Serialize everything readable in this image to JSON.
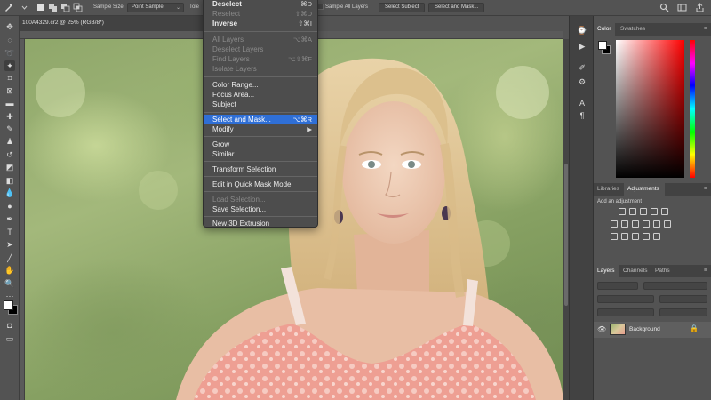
{
  "options_bar": {
    "sample_size_label": "Sample Size:",
    "sample_size_value": "Point Sample",
    "tolerance_label_partial": "Tole",
    "sample_all_layers": "Sample All Layers",
    "select_subject": "Select Subject",
    "select_and_mask": "Select and Mask..."
  },
  "document": {
    "tab_title": "100A4329.cr2 @ 25% (RGB/8*)"
  },
  "menu": {
    "items": [
      {
        "label": "Deselect",
        "shortcut": "⌘D",
        "enabled": true
      },
      {
        "label": "Reselect",
        "shortcut": "⇧⌘D",
        "enabled": false
      },
      {
        "label": "Inverse",
        "shortcut": "⇧⌘I",
        "enabled": true
      },
      {
        "label": "All Layers",
        "shortcut": "⌥⌘A",
        "enabled": false
      },
      {
        "label": "Deselect Layers",
        "shortcut": "",
        "enabled": false
      },
      {
        "label": "Find Layers",
        "shortcut": "⌥⇧⌘F",
        "enabled": false
      },
      {
        "label": "Isolate Layers",
        "shortcut": "",
        "enabled": false
      },
      {
        "label": "Color Range...",
        "shortcut": "",
        "enabled": true
      },
      {
        "label": "Focus Area...",
        "shortcut": "",
        "enabled": true
      },
      {
        "label": "Subject",
        "shortcut": "",
        "enabled": true
      },
      {
        "label": "Select and Mask...",
        "shortcut": "⌥⌘R",
        "enabled": true,
        "highlighted": true
      },
      {
        "label": "Modify",
        "shortcut": "▶",
        "enabled": true
      },
      {
        "label": "Grow",
        "shortcut": "",
        "enabled": true
      },
      {
        "label": "Similar",
        "shortcut": "",
        "enabled": true
      },
      {
        "label": "Transform Selection",
        "shortcut": "",
        "enabled": true
      },
      {
        "label": "Edit in Quick Mask Mode",
        "shortcut": "",
        "enabled": true
      },
      {
        "label": "Load Selection...",
        "shortcut": "",
        "enabled": false
      },
      {
        "label": "Save Selection...",
        "shortcut": "",
        "enabled": true
      },
      {
        "label": "New 3D Extrusion",
        "shortcut": "",
        "enabled": true
      }
    ]
  },
  "panels": {
    "color_tabs": [
      "Color",
      "Swatches"
    ],
    "adjust_tabs": [
      "Libraries",
      "Adjustments"
    ],
    "add_adjustment": "Add an adjustment",
    "layers_tabs": [
      "Layers",
      "Channels",
      "Paths"
    ],
    "layer_name": "Background"
  },
  "colors": {
    "highlight": "#2f6fd6",
    "foreground": "#ffffff",
    "background": "#000000"
  }
}
